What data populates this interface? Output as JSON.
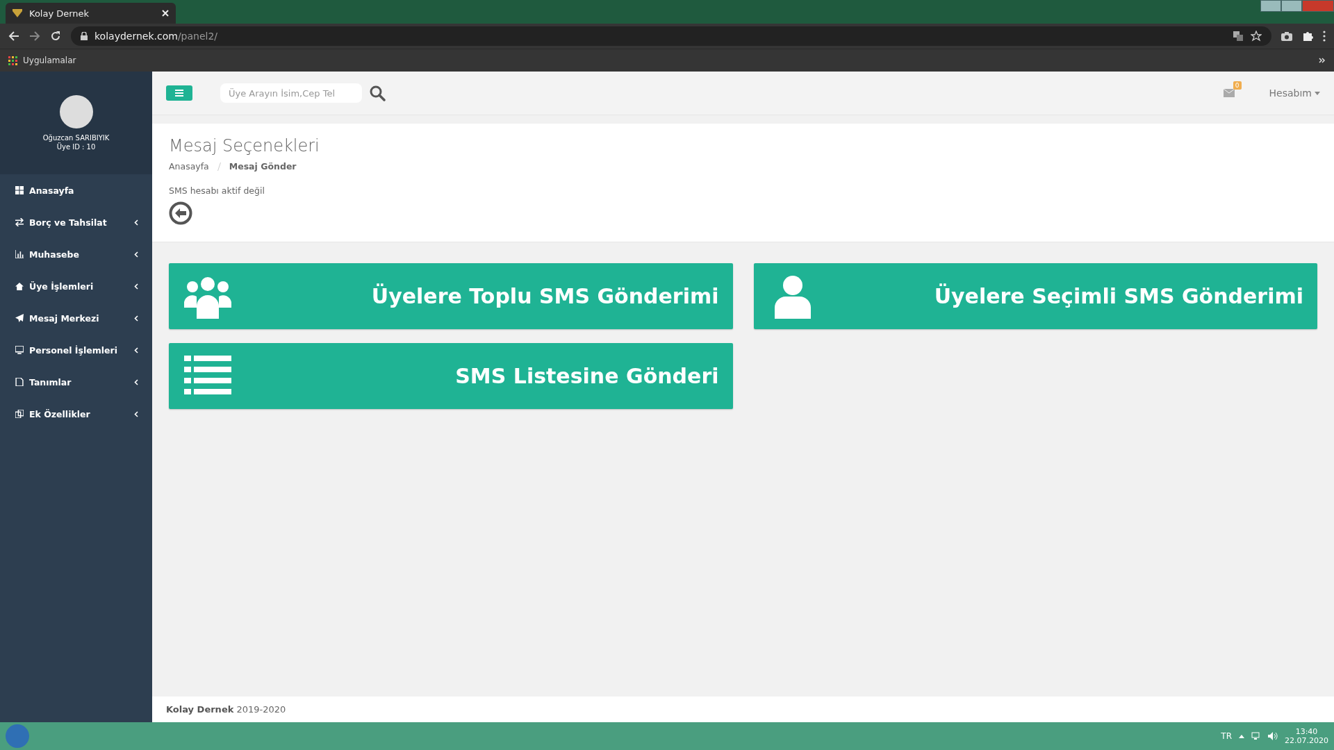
{
  "browser": {
    "tab_title": "Kolay Dernek",
    "url_host": "kolaydernek.com",
    "url_path": "/panel2/",
    "bookmarks": [
      "Uygulamalar"
    ]
  },
  "sidebar": {
    "user_name": "Oğuzcan SARIBIYIK",
    "user_id": "Üye ID : 10",
    "items": [
      {
        "label": "Anasayfa",
        "expandable": false
      },
      {
        "label": "Borç ve Tahsilat",
        "expandable": true
      },
      {
        "label": "Muhasebe",
        "expandable": true
      },
      {
        "label": "Üye İşlemleri",
        "expandable": true
      },
      {
        "label": "Mesaj Merkezi",
        "expandable": true
      },
      {
        "label": "Personel İşlemleri",
        "expandable": true
      },
      {
        "label": "Tanımlar",
        "expandable": true
      },
      {
        "label": "Ek Özellikler",
        "expandable": true
      }
    ]
  },
  "topbar": {
    "search": {
      "placeholder": "Üye Arayın İsim,Cep Tel"
    },
    "message_count": "0",
    "account": "Hesabım"
  },
  "page": {
    "title": "Mesaj Seçenekleri",
    "breadcrumb": [
      {
        "label": "Anasayfa",
        "current": false
      },
      {
        "label": "Mesaj Gönder",
        "current": true
      }
    ],
    "notice": "SMS hesabı aktif değil",
    "cards": [
      {
        "label": "Üyelere Toplu SMS Gönderimi",
        "kind": "group"
      },
      {
        "label": "Üyelere Seçimli SMS Gönderimi",
        "kind": "user"
      },
      {
        "label": "SMS Listesine Gönderi",
        "kind": "list"
      }
    ]
  },
  "footer": "**Kolay Dernek** 2019-2020",
  "taskbar": {
    "language": "TR",
    "time": "13:40",
    "date": "22.07.2020"
  }
}
